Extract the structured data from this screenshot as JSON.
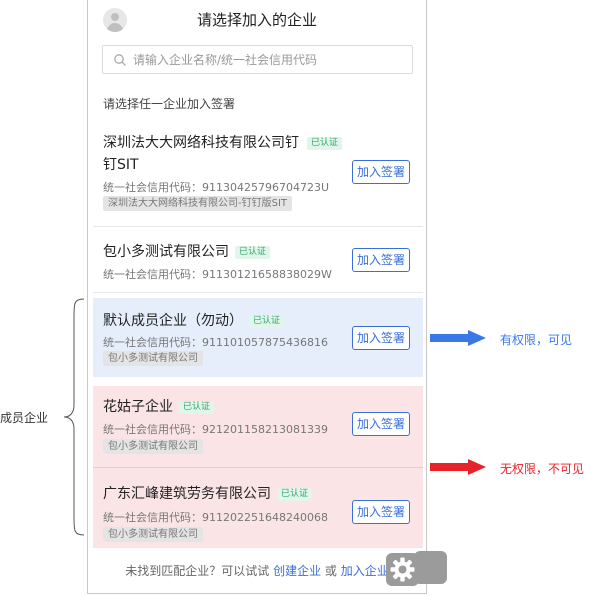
{
  "header": {
    "title": "请选择加入的企业"
  },
  "search": {
    "placeholder": "请输入企业名称/统一社会信用代码"
  },
  "hint": "请选择任一企业加入签署",
  "verified_badge": "已认证",
  "join_label": "加入签署",
  "companies": [
    {
      "name_line1": "深圳法大大网络科技有限公司钉",
      "name_line2": "钉SIT",
      "code": "统一社会信用代码：91130425796704723U",
      "tag": "深圳法大大网络科技有限公司-钉钉版SIT"
    },
    {
      "name": "包小多测试有限公司",
      "code": "统一社会信用代码：91130121658838029W"
    },
    {
      "name": "默认成员企业（勿动）",
      "code": "统一社会信用代码：911101057875436816",
      "tag": "包小多测试有限公司"
    },
    {
      "name": "花姑子企业",
      "code": "统一社会信用代码：921201158213081339",
      "tag": "包小多测试有限公司"
    },
    {
      "name": "广东汇峰建筑劳务有限公司",
      "code": "统一社会信用代码：911202251648240068",
      "tag": "包小多测试有限公司"
    }
  ],
  "footer": {
    "prefix": "未找到匹配企业？可以试试",
    "create_link": "创建企业",
    "or": "或",
    "join_link": "加入企业"
  },
  "annotations": {
    "member_label": "成员企业",
    "visible_note": "有权限，可见",
    "hidden_note": "无权限，不可见",
    "visible_color": "#3a78e8",
    "hidden_color": "#e8222a"
  }
}
